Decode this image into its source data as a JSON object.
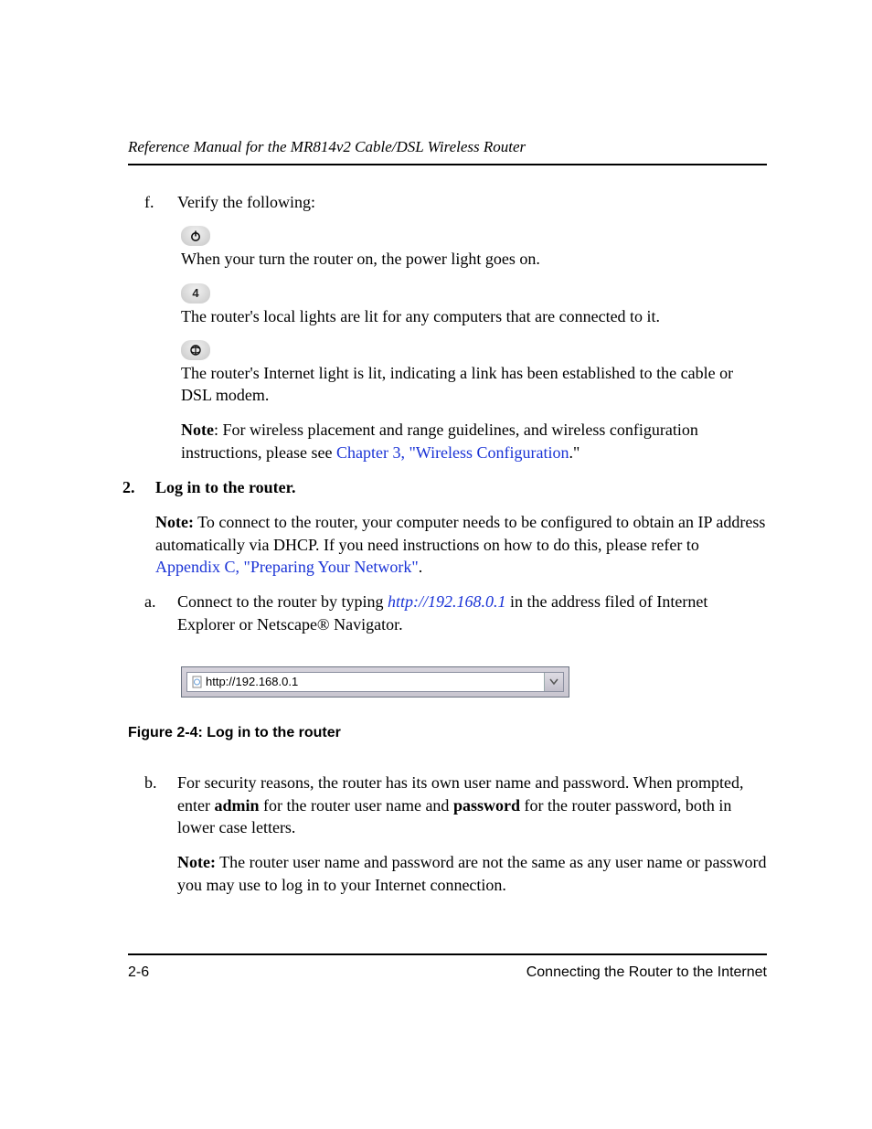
{
  "header": {
    "running_title": "Reference Manual for the MR814v2 Cable/DSL Wireless Router"
  },
  "content": {
    "item_f": {
      "marker": "f.",
      "lead": "Verify the following:",
      "bullets": [
        {
          "icon": "power",
          "text": "When your turn the router on, the power light goes on."
        },
        {
          "icon": "four",
          "text": "The router's local lights are lit for any computers that are connected to it."
        },
        {
          "icon": "internet",
          "text": "The router's Internet light is lit, indicating a link has been established to the cable or DSL modem."
        }
      ],
      "note_label": "Note",
      "note_pre": ": For wireless placement and range guidelines, and wireless configuration instructions, please see ",
      "note_link": "Chapter 3, \"Wireless Configuration",
      "note_post": ".\""
    },
    "step2": {
      "marker": "2.",
      "title": "Log in to the router.",
      "note_label": "Note:",
      "note_body_pre": " To connect to the router, your computer needs to be configured to obtain an IP address automatically via DHCP. If you need instructions on how to do this, please refer to ",
      "note_link": "Appendix C, \"Preparing Your Network\"",
      "note_body_post": ".",
      "sub_a": {
        "marker": "a.",
        "pre": "Connect to the router by typing ",
        "url": "http://192.168.0.1",
        "post": " in the address filed of Internet Explorer or Netscape® Navigator."
      },
      "address_bar": {
        "value": "http://192.168.0.1"
      },
      "figure_caption": "Figure 2-4:  Log in to the router",
      "sub_b": {
        "marker": "b.",
        "seg1": "For security reasons, the router has its own user name and password. When prompted, enter ",
        "admin": "admin",
        "seg2": "  for the router user name and ",
        "password": "password",
        "seg3": " for the router password, both in lower case letters.",
        "note_label": "Note:",
        "note_body": " The router user name and password are not the same as any user name or password you may use to log in to your Internet connection."
      }
    }
  },
  "footer": {
    "page": "2-6",
    "section": "Connecting the Router to the Internet"
  }
}
